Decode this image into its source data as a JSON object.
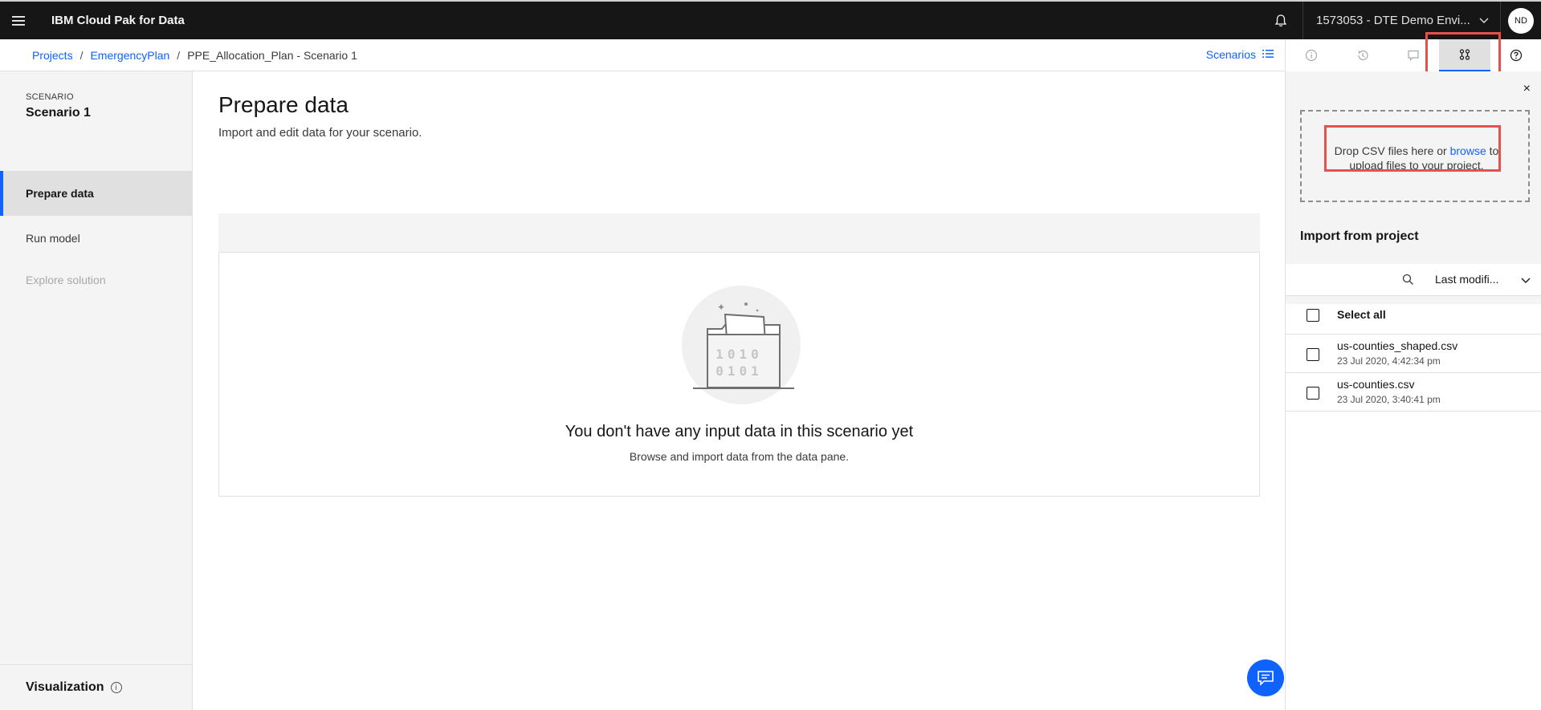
{
  "header": {
    "brand": "IBM Cloud Pak for Data",
    "account_label": "1573053 - DTE Demo Envi...",
    "avatar_initials": "ND",
    "icons": [
      "menu-icon",
      "bell-icon",
      "chevron-down-icon"
    ]
  },
  "breadcrumb": {
    "items": [
      "Projects",
      "EmergencyPlan"
    ],
    "current": "PPE_Allocation_Plan - Scenario 1",
    "separator": "/",
    "scenarios_label": "Scenarios"
  },
  "sidebar": {
    "section_label": "SCENARIO",
    "scenario_name": "Scenario 1",
    "items": [
      {
        "label": "Prepare data",
        "state": "active"
      },
      {
        "label": "Run model",
        "state": "enabled"
      },
      {
        "label": "Explore solution",
        "state": "disabled"
      }
    ],
    "footer_label": "Visualization"
  },
  "main": {
    "title": "Prepare data",
    "subtitle": "Import and edit data for your scenario.",
    "illustration_text": [
      "1010",
      "0101"
    ],
    "empty_title": "You don't have any input data in this scenario yet",
    "empty_desc": "Browse and import data from the data pane."
  },
  "right_panel": {
    "tabs": [
      "info-icon",
      "history-icon",
      "comment-icon",
      "data-icon",
      "help-icon"
    ],
    "active_tab": "data-icon",
    "close_symbol": "×",
    "dropzone": {
      "text_before": "Drop CSV files here or ",
      "link": "browse",
      "text_after": " to upload files to your project."
    },
    "import_title": "Import from project",
    "sort_label": "Last modifi...",
    "select_all": "Select all",
    "files": [
      {
        "name": "us-counties_shaped.csv",
        "date": "23 Jul 2020, 4:42:34 pm"
      },
      {
        "name": "us-counties.csv",
        "date": "23 Jul 2020, 3:40:41 pm"
      }
    ]
  },
  "colors": {
    "accent": "#0f62fe",
    "header_bg": "#161616",
    "highlight": "#e8504a"
  }
}
